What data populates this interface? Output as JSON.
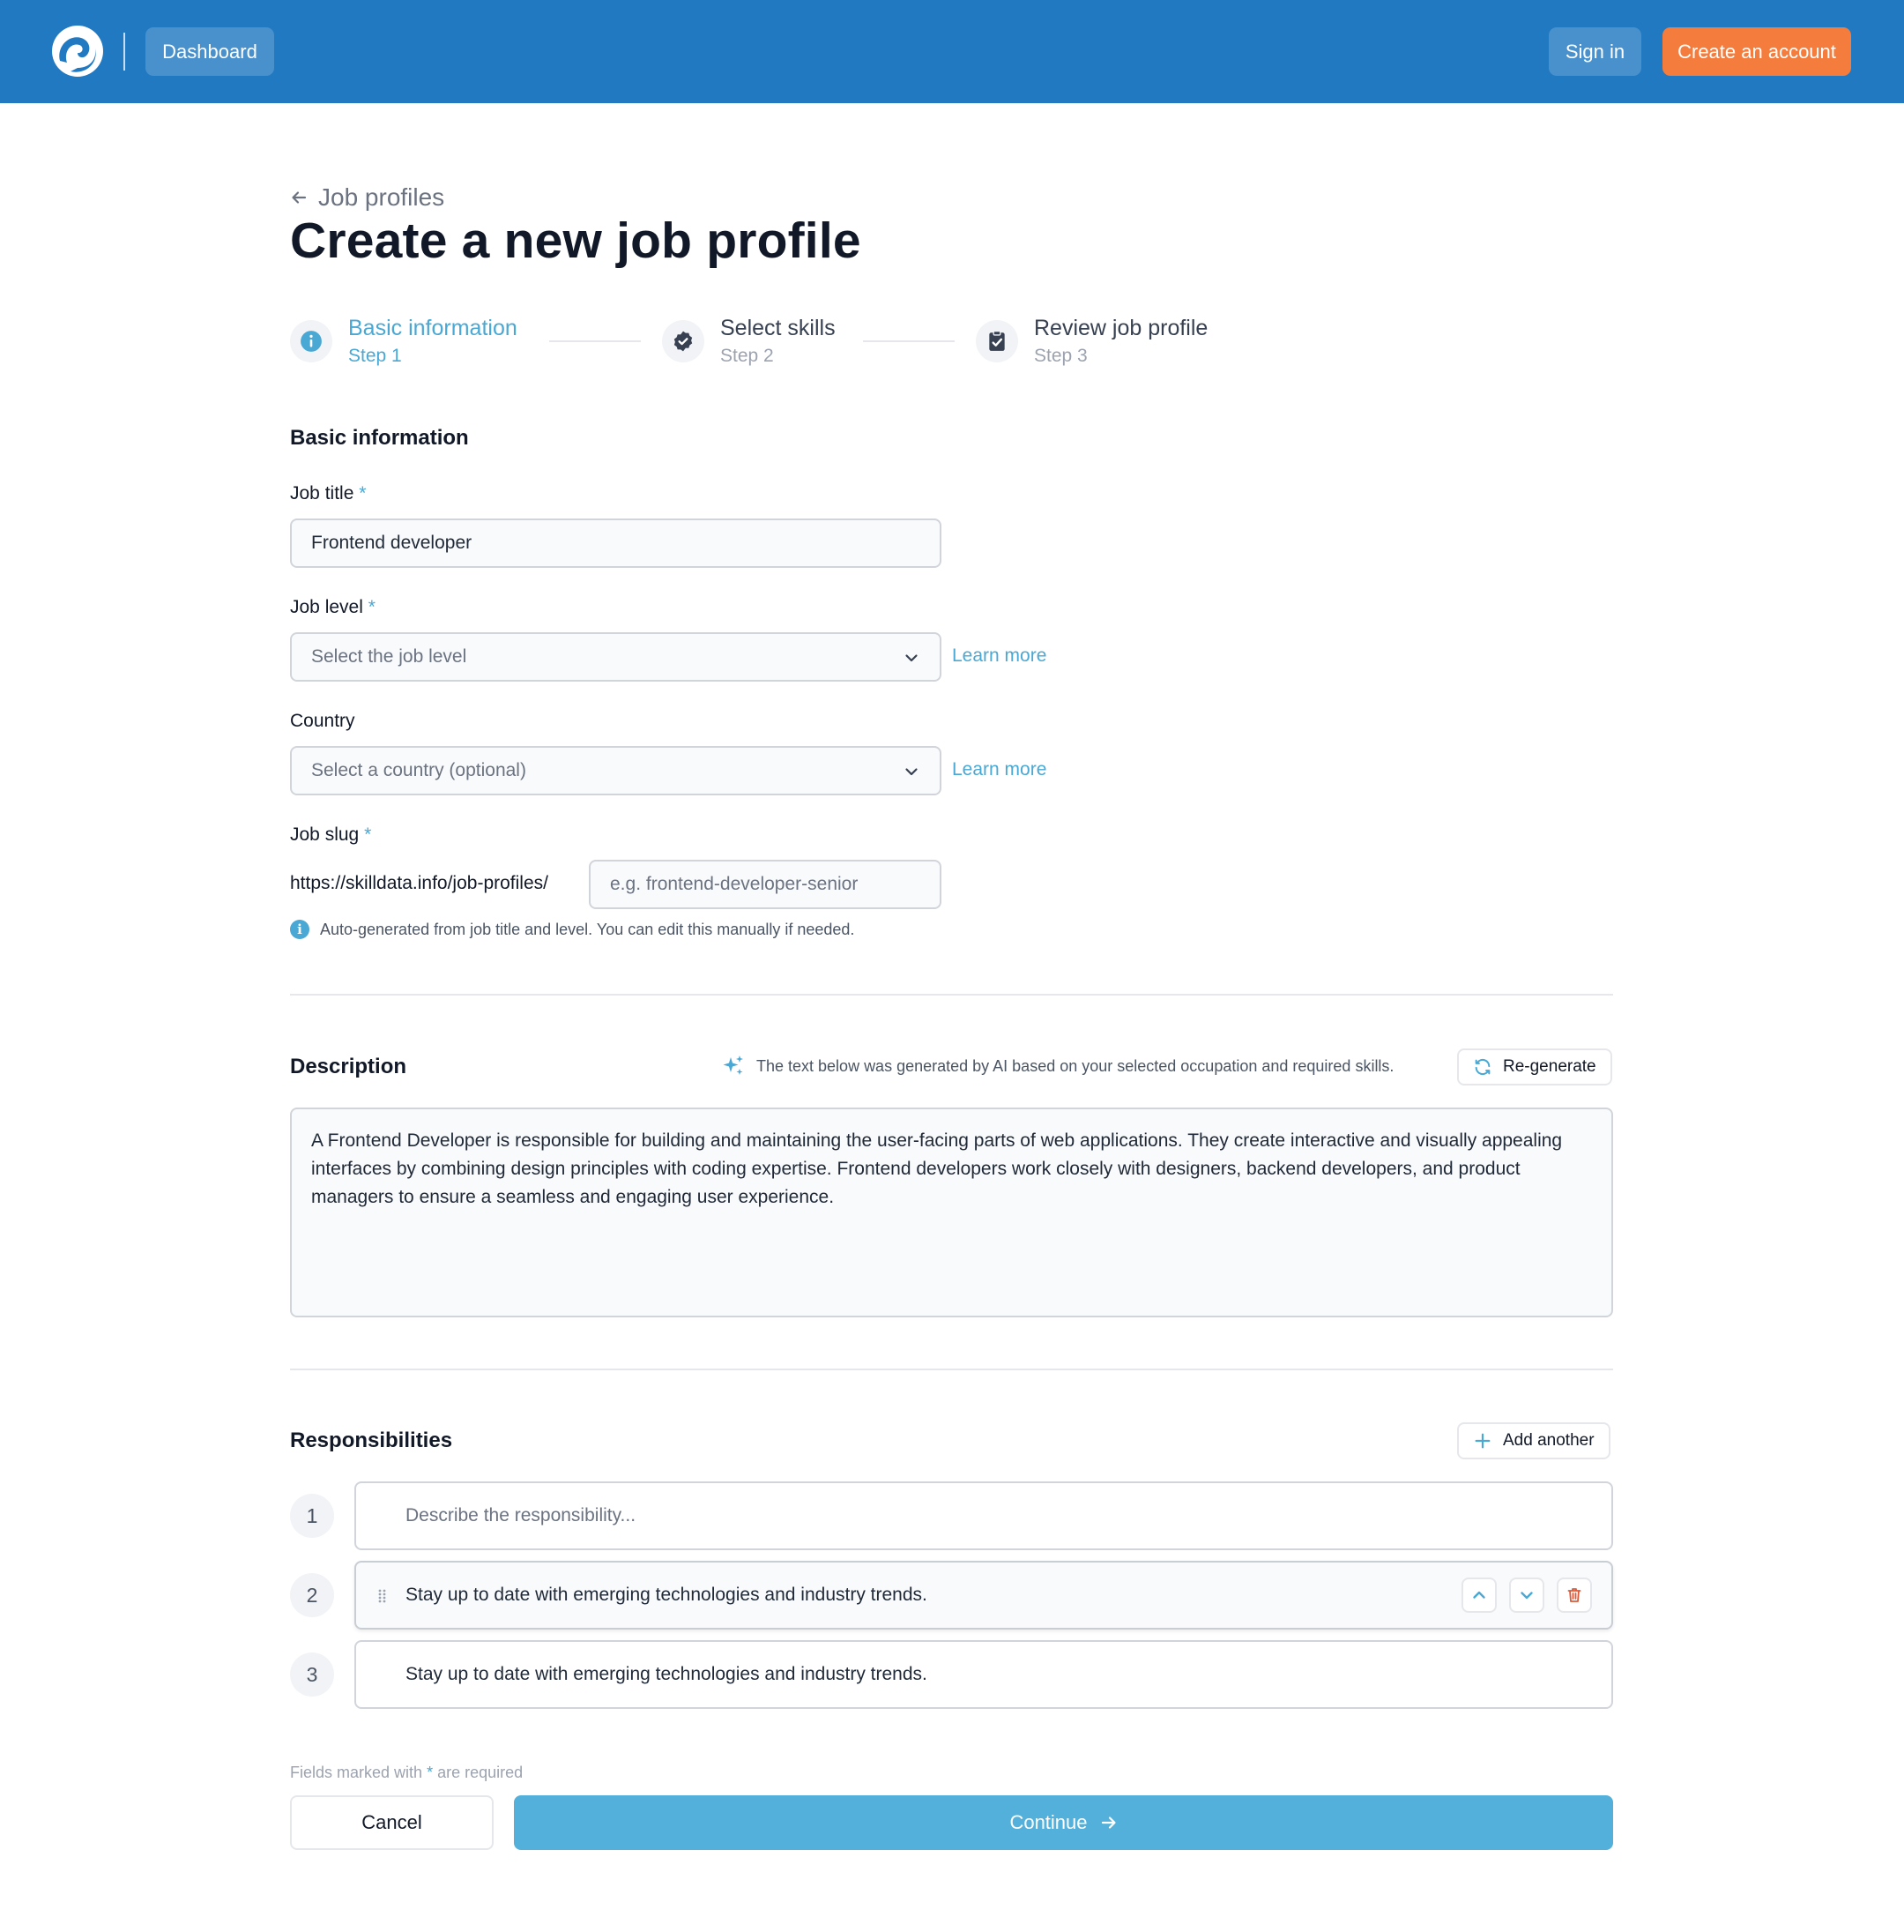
{
  "header": {
    "dashboard_label": "Dashboard",
    "signin_label": "Sign in",
    "create_account_label": "Create an account"
  },
  "page": {
    "back_label": "Job profiles",
    "title": "Create a new job profile"
  },
  "steps": [
    {
      "title": "Basic information",
      "sub": "Step 1",
      "state": "active",
      "icon": "info-icon"
    },
    {
      "title": "Select skills",
      "sub": "Step 2",
      "state": "pending",
      "icon": "badge-check-icon"
    },
    {
      "title": "Review job profile",
      "sub": "Step 3",
      "state": "pending",
      "icon": "clipboard-check-icon"
    }
  ],
  "basic": {
    "heading": "Basic information",
    "job_title_label": "Job title",
    "job_title_value": "Frontend developer",
    "job_level_label": "Job level",
    "job_level_placeholder": "Select the job level",
    "country_label": "Country",
    "country_placeholder": "Select a country (optional)",
    "learn_more": "Learn more",
    "slug_label": "Job slug",
    "slug_prefix": "https://skilldata.info/job-profiles/",
    "slug_placeholder": "e.g. frontend-developer-senior",
    "slug_hint": "Auto-generated from job title and level. You can edit this manually if needed.",
    "required_mark": "*"
  },
  "description": {
    "heading": "Description",
    "ai_note": "The text below was generated by AI based on your selected occupation and required skills.",
    "regenerate_label": "Re-generate",
    "text": "A Frontend Developer is responsible for building and maintaining the user-facing parts of web applications. They create interactive and visually appealing interfaces by combining design principles with coding expertise. Frontend developers work closely with designers, backend developers, and product managers to ensure a seamless and engaging user experience."
  },
  "responsibilities": {
    "heading": "Responsibilities",
    "add_label": "Add another",
    "placeholder": "Describe the responsibility...",
    "items": [
      {
        "num": "1",
        "text": ""
      },
      {
        "num": "2",
        "text": "Stay up to date with emerging technologies and industry trends."
      },
      {
        "num": "3",
        "text": "Stay up to date with emerging technologies and industry trends."
      }
    ]
  },
  "footer": {
    "note_before": "Fields marked with",
    "note_mark": "*",
    "note_after": "are required",
    "cancel_label": "Cancel",
    "continue_label": "Continue"
  },
  "colors": {
    "topbar": "#2179c1",
    "accent": "#4aa8d4",
    "cta_orange": "#f47c3c",
    "continue": "#52b0da",
    "danger": "#dc5a3a"
  }
}
